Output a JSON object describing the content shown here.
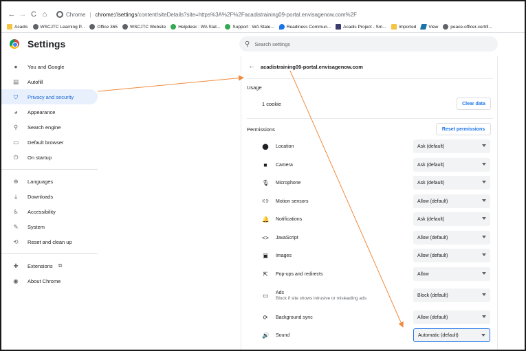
{
  "address_bar": {
    "site_label": "Chrome",
    "url_bold": "chrome://settings",
    "url_rest": "/content/siteDetails?site=https%3A%2F%2Facadistraining09-portal.envisagenow.com%2F"
  },
  "bookmarks": [
    {
      "label": "Acadis",
      "icon": "folder-icon"
    },
    {
      "label": "WSCJTC Learning P...",
      "icon": "globe-icon"
    },
    {
      "label": "Office 365",
      "icon": "globe-icon"
    },
    {
      "label": "WSCJTC Website",
      "icon": "globe-icon"
    },
    {
      "label": "Helpdesk : WA Stat...",
      "icon": "green-circle-icon"
    },
    {
      "label": "Support : WA State...",
      "icon": "green-circle-icon"
    },
    {
      "label": "Readiness Commun...",
      "icon": "blue-cloud-icon"
    },
    {
      "label": "Acadis Project - Sm...",
      "icon": "dark-icon"
    },
    {
      "label": "Imported",
      "icon": "folder-icon"
    },
    {
      "label": "View",
      "icon": "teal-icon"
    },
    {
      "label": "peace-officer-certifi...",
      "icon": "globe-icon"
    }
  ],
  "header": {
    "title": "Settings",
    "search_placeholder": "Search settings"
  },
  "sidebar": {
    "group1": [
      {
        "label": "You and Google",
        "icon": "person-icon",
        "glyph": "●"
      },
      {
        "label": "Autofill",
        "icon": "clipboard-icon",
        "glyph": "▤"
      },
      {
        "label": "Privacy and security",
        "icon": "shield-icon",
        "glyph": "⛉",
        "active": true
      },
      {
        "label": "Appearance",
        "icon": "palette-icon",
        "glyph": "◕"
      },
      {
        "label": "Search engine",
        "icon": "search-icon",
        "glyph": "⚲"
      },
      {
        "label": "Default browser",
        "icon": "browser-icon",
        "glyph": "▭"
      },
      {
        "label": "On startup",
        "icon": "power-icon",
        "glyph": "⏻"
      }
    ],
    "group2": [
      {
        "label": "Languages",
        "icon": "globe-icon",
        "glyph": "⊕"
      },
      {
        "label": "Downloads",
        "icon": "download-icon",
        "glyph": "⤓"
      },
      {
        "label": "Accessibility",
        "icon": "accessibility-icon",
        "glyph": "♿"
      },
      {
        "label": "System",
        "icon": "wrench-icon",
        "glyph": "✎"
      },
      {
        "label": "Reset and clean up",
        "icon": "restore-icon",
        "glyph": "⟲"
      }
    ],
    "group3": [
      {
        "label": "Extensions",
        "icon": "puzzle-icon",
        "glyph": "✚"
      },
      {
        "label": "About Chrome",
        "icon": "chrome-icon",
        "glyph": "◉"
      }
    ]
  },
  "main": {
    "site": "acadistraining09-portal.envisagenow.com",
    "usage_heading": "Usage",
    "cookie_count": "1 cookie",
    "clear_button": "Clear data",
    "permissions_heading": "Permissions",
    "reset_button": "Reset permissions",
    "permissions": [
      {
        "label": "Location",
        "icon": "location-icon",
        "glyph": "⬤",
        "value": "Ask (default)"
      },
      {
        "label": "Camera",
        "icon": "camera-icon",
        "glyph": "■",
        "value": "Ask (default)"
      },
      {
        "label": "Microphone",
        "icon": "microphone-icon",
        "glyph": "🎙",
        "value": "Ask (default)"
      },
      {
        "label": "Motion sensors",
        "icon": "motion-sensor-icon",
        "glyph": "((·))",
        "value": "Allow (default)"
      },
      {
        "label": "Notifications",
        "icon": "bell-icon",
        "glyph": "🔔",
        "value": "Ask (default)"
      },
      {
        "label": "JavaScript",
        "icon": "code-icon",
        "glyph": "<>",
        "value": "Allow (default)"
      },
      {
        "label": "Images",
        "icon": "image-icon",
        "glyph": "▣",
        "value": "Allow (default)"
      },
      {
        "label": "Pop-ups and redirects",
        "icon": "popup-icon",
        "glyph": "⇱",
        "value": "Allow"
      },
      {
        "label": "Ads",
        "sublabel": "Block if site shows intrusive or misleading ads",
        "icon": "ads-icon",
        "glyph": "▭",
        "value": "Block (default)"
      },
      {
        "label": "Background sync",
        "icon": "sync-icon",
        "glyph": "⟳",
        "value": "Allow (default)"
      },
      {
        "label": "Sound",
        "icon": "speaker-icon",
        "glyph": "🔊",
        "value": "Automatic (default)",
        "focused": true
      }
    ]
  },
  "colors": {
    "accent": "#1a73e8",
    "annotation_arrow": "#f08a3c",
    "active_bg": "#e8f0fe"
  }
}
